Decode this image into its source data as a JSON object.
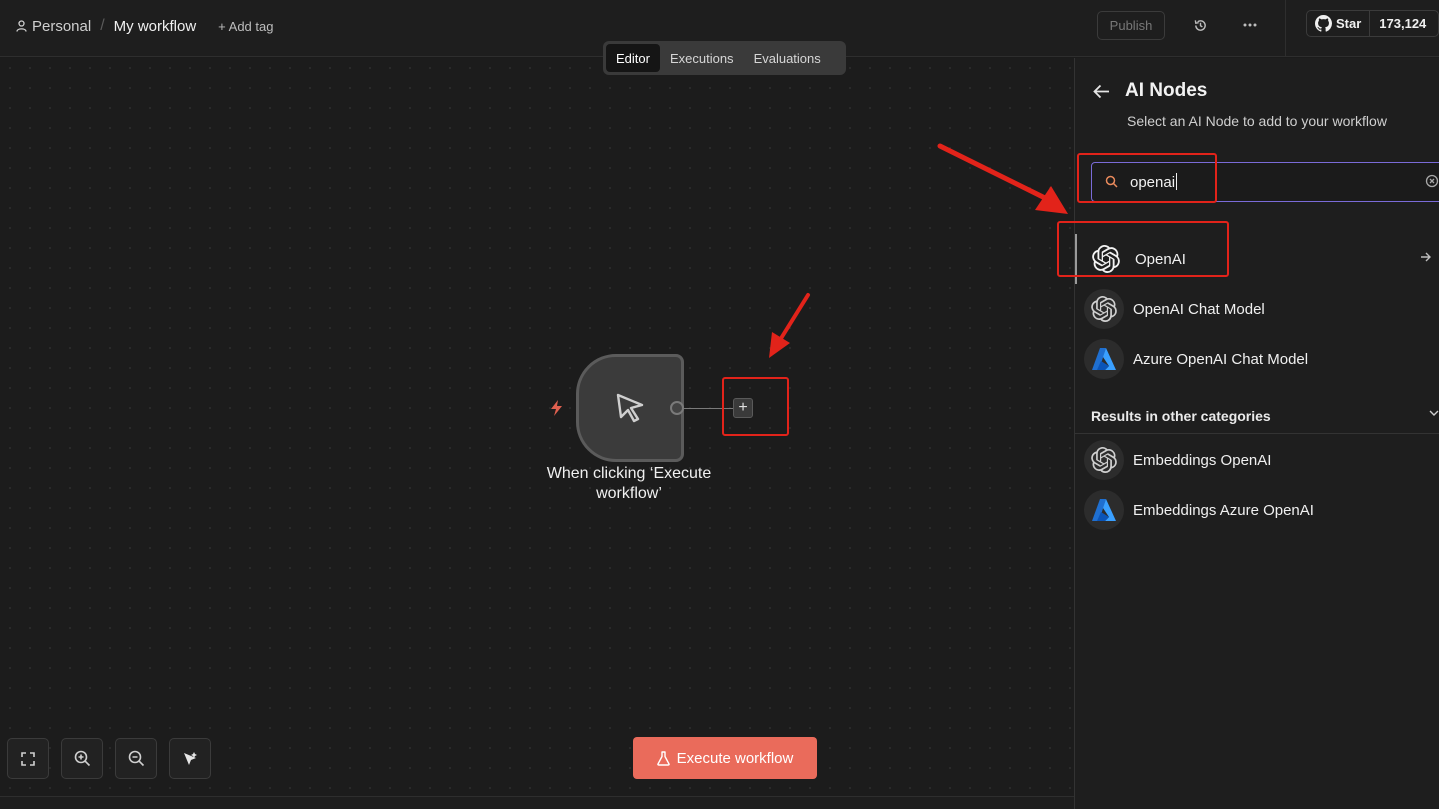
{
  "header": {
    "project": "Personal",
    "separator": "/",
    "workflow_name": "My workflow",
    "add_tag": "+ Add tag",
    "publish": "Publish",
    "github_star": "Star",
    "github_count": "173,124"
  },
  "tabs": [
    {
      "label": "Editor",
      "active": true
    },
    {
      "label": "Executions",
      "active": false
    },
    {
      "label": "Evaluations",
      "active": false
    }
  ],
  "canvas": {
    "node_label": "When clicking ‘Execute workflow’",
    "node_icon": "pointer-icon",
    "add_button": "+",
    "execute_button": "Execute workflow",
    "controls": [
      "fit-view-icon",
      "zoom-in-icon",
      "zoom-out-icon",
      "tidy-up-icon"
    ]
  },
  "panel": {
    "title": "AI Nodes",
    "subtitle": "Select an AI Node to add to your workflow",
    "search_value": "openai",
    "results": [
      {
        "label": "OpenAI",
        "icon": "openai-icon"
      },
      {
        "label": "OpenAI Chat Model",
        "icon": "openai-icon"
      },
      {
        "label": "Azure OpenAI Chat Model",
        "icon": "azure-icon"
      }
    ],
    "other_categories_title": "Results in other categories",
    "other_results": [
      {
        "label": "Embeddings OpenAI",
        "icon": "openai-icon"
      },
      {
        "label": "Embeddings Azure OpenAI",
        "icon": "azure-icon"
      }
    ]
  },
  "colors": {
    "accent": "#ea6b5b",
    "search_focus": "#7a6bd8",
    "annotation": "#e2231a",
    "azure_blue": "#2d8cf0"
  }
}
